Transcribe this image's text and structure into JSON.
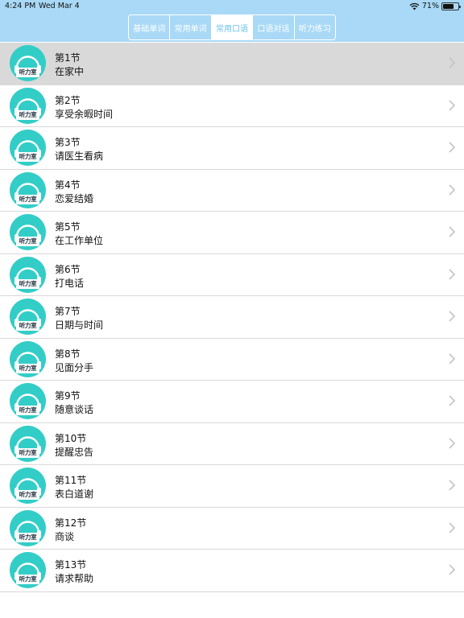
{
  "status": {
    "time": "4:24 PM",
    "date": "Wed Mar 4",
    "battery": "71%",
    "battery_level": 0.71
  },
  "tabs": [
    {
      "label": "基础单词",
      "active": false
    },
    {
      "label": "常用单词",
      "active": false
    },
    {
      "label": "常用口语",
      "active": true
    },
    {
      "label": "口语对话",
      "active": false
    },
    {
      "label": "听力练习",
      "active": false
    }
  ],
  "avatar_badge": "听力室",
  "lessons": [
    {
      "title": "第1节",
      "subtitle": "在家中",
      "selected": true
    },
    {
      "title": "第2节",
      "subtitle": "享受余暇时间"
    },
    {
      "title": "第3节",
      "subtitle": "请医生看病"
    },
    {
      "title": "第4节",
      "subtitle": "恋爱结婚"
    },
    {
      "title": "第5节",
      "subtitle": "在工作单位"
    },
    {
      "title": "第6节",
      "subtitle": "打电话"
    },
    {
      "title": "第7节",
      "subtitle": "日期与时间"
    },
    {
      "title": "第8节",
      "subtitle": "见面分手"
    },
    {
      "title": "第9节",
      "subtitle": "随意谈话"
    },
    {
      "title": "第10节",
      "subtitle": "提醒忠告"
    },
    {
      "title": "第11节",
      "subtitle": "表白道谢"
    },
    {
      "title": "第12节",
      "subtitle": "商谈"
    },
    {
      "title": "第13节",
      "subtitle": "请求帮助"
    }
  ],
  "colors": {
    "accent": "#a9d9f6",
    "avatar": "#33cdc7",
    "selected_row": "#d9d9d9"
  }
}
